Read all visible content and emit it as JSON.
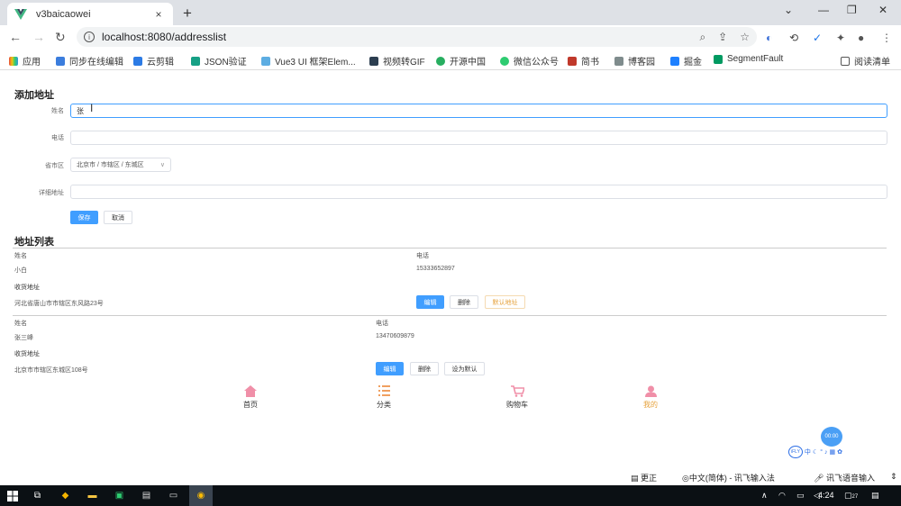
{
  "browser": {
    "tab_title": "v3baicaowei",
    "tab_close": "×",
    "new_tab": "+",
    "url": "localhost:8080/addresslist",
    "minimize": "—",
    "restore": "❐",
    "close": "✕",
    "chevron": "⌄"
  },
  "bookmarks": [
    {
      "label": "应用",
      "color": "#e74c3c"
    },
    {
      "label": "同步在线编辑",
      "color": "#3b7ddd"
    },
    {
      "label": "云剪辑",
      "color": "#2c7be5"
    },
    {
      "label": "JSON验证",
      "color": "#16a085"
    },
    {
      "label": "Vue3 UI 框架Elem...",
      "color": "#5dade2"
    },
    {
      "label": "视频转GIF",
      "color": "#2c3e50"
    },
    {
      "label": "开源中国",
      "color": "#27ae60"
    },
    {
      "label": "微信公众号",
      "color": "#2ecc71"
    },
    {
      "label": "简书",
      "color": "#c0392b"
    },
    {
      "label": "博客园",
      "color": "#7f8c8d"
    },
    {
      "label": "掘金",
      "color": "#1e80ff"
    },
    {
      "label": "SegmentFault",
      "color": "#009a61"
    }
  ],
  "reading_list": "阅读清单",
  "form": {
    "title": "添加地址",
    "name_label": "姓名",
    "name_value": "张",
    "phone_label": "电话",
    "phone_value": "",
    "region_label": "省市区",
    "region_value": "北京市 / 市辖区 / 东城区",
    "detail_label": "详细地址",
    "detail_value": "",
    "save_button": "保存",
    "cancel_button": "取消"
  },
  "list": {
    "title": "地址列表",
    "entries": [
      {
        "name_label": "姓名",
        "name": "小白",
        "phone_label": "电话",
        "phone": "15333652897",
        "address_label": "收货地址",
        "address": "河北省唐山市市辖区东风路23号",
        "edit_button": "编辑",
        "delete_button": "删除",
        "default_button": "默认地址"
      },
      {
        "name_label": "姓名",
        "name": "张三峰",
        "phone_label": "电话",
        "phone": "13470609879",
        "address_label": "收货地址",
        "address": "北京市市辖区东城区108号",
        "edit_button": "编辑",
        "delete_button": "删除",
        "default_button": "设为默认"
      }
    ]
  },
  "bottom_nav": [
    {
      "label": "首页",
      "icon": "home-icon"
    },
    {
      "label": "分类",
      "icon": "list-icon"
    },
    {
      "label": "购物车",
      "icon": "cart-icon"
    },
    {
      "label": "我的",
      "icon": "user-icon"
    }
  ],
  "ime": {
    "timer": "00:00",
    "brand": "iFLY",
    "update": "更正",
    "input_method": "中文(简体) - 讯飞输入法",
    "voice": "讯飞语音输入"
  },
  "taskbar": {
    "time": "4:24",
    "badge": "27"
  },
  "colors": {
    "primary": "#409eff",
    "warning": "#e6a23c",
    "pink_icon": "#f08fa8"
  }
}
